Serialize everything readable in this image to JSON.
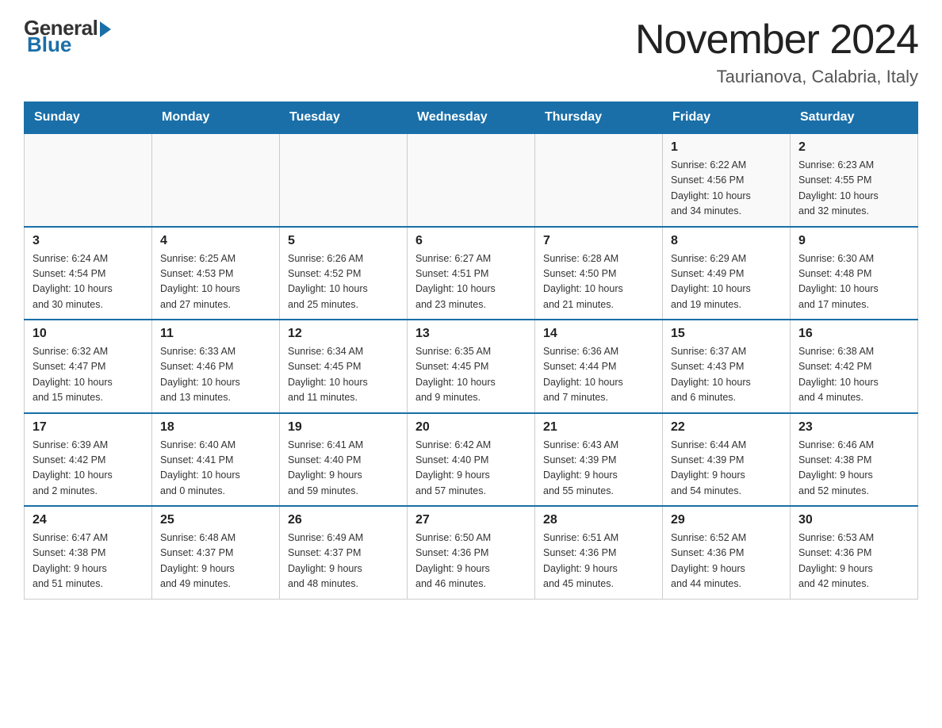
{
  "header": {
    "logo": {
      "general": "General",
      "blue": "Blue"
    },
    "month": "November 2024",
    "location": "Taurianova, Calabria, Italy"
  },
  "weekdays": [
    "Sunday",
    "Monday",
    "Tuesday",
    "Wednesday",
    "Thursday",
    "Friday",
    "Saturday"
  ],
  "weeks": [
    [
      {
        "day": "",
        "info": ""
      },
      {
        "day": "",
        "info": ""
      },
      {
        "day": "",
        "info": ""
      },
      {
        "day": "",
        "info": ""
      },
      {
        "day": "",
        "info": ""
      },
      {
        "day": "1",
        "info": "Sunrise: 6:22 AM\nSunset: 4:56 PM\nDaylight: 10 hours\nand 34 minutes."
      },
      {
        "day": "2",
        "info": "Sunrise: 6:23 AM\nSunset: 4:55 PM\nDaylight: 10 hours\nand 32 minutes."
      }
    ],
    [
      {
        "day": "3",
        "info": "Sunrise: 6:24 AM\nSunset: 4:54 PM\nDaylight: 10 hours\nand 30 minutes."
      },
      {
        "day": "4",
        "info": "Sunrise: 6:25 AM\nSunset: 4:53 PM\nDaylight: 10 hours\nand 27 minutes."
      },
      {
        "day": "5",
        "info": "Sunrise: 6:26 AM\nSunset: 4:52 PM\nDaylight: 10 hours\nand 25 minutes."
      },
      {
        "day": "6",
        "info": "Sunrise: 6:27 AM\nSunset: 4:51 PM\nDaylight: 10 hours\nand 23 minutes."
      },
      {
        "day": "7",
        "info": "Sunrise: 6:28 AM\nSunset: 4:50 PM\nDaylight: 10 hours\nand 21 minutes."
      },
      {
        "day": "8",
        "info": "Sunrise: 6:29 AM\nSunset: 4:49 PM\nDaylight: 10 hours\nand 19 minutes."
      },
      {
        "day": "9",
        "info": "Sunrise: 6:30 AM\nSunset: 4:48 PM\nDaylight: 10 hours\nand 17 minutes."
      }
    ],
    [
      {
        "day": "10",
        "info": "Sunrise: 6:32 AM\nSunset: 4:47 PM\nDaylight: 10 hours\nand 15 minutes."
      },
      {
        "day": "11",
        "info": "Sunrise: 6:33 AM\nSunset: 4:46 PM\nDaylight: 10 hours\nand 13 minutes."
      },
      {
        "day": "12",
        "info": "Sunrise: 6:34 AM\nSunset: 4:45 PM\nDaylight: 10 hours\nand 11 minutes."
      },
      {
        "day": "13",
        "info": "Sunrise: 6:35 AM\nSunset: 4:45 PM\nDaylight: 10 hours\nand 9 minutes."
      },
      {
        "day": "14",
        "info": "Sunrise: 6:36 AM\nSunset: 4:44 PM\nDaylight: 10 hours\nand 7 minutes."
      },
      {
        "day": "15",
        "info": "Sunrise: 6:37 AM\nSunset: 4:43 PM\nDaylight: 10 hours\nand 6 minutes."
      },
      {
        "day": "16",
        "info": "Sunrise: 6:38 AM\nSunset: 4:42 PM\nDaylight: 10 hours\nand 4 minutes."
      }
    ],
    [
      {
        "day": "17",
        "info": "Sunrise: 6:39 AM\nSunset: 4:42 PM\nDaylight: 10 hours\nand 2 minutes."
      },
      {
        "day": "18",
        "info": "Sunrise: 6:40 AM\nSunset: 4:41 PM\nDaylight: 10 hours\nand 0 minutes."
      },
      {
        "day": "19",
        "info": "Sunrise: 6:41 AM\nSunset: 4:40 PM\nDaylight: 9 hours\nand 59 minutes."
      },
      {
        "day": "20",
        "info": "Sunrise: 6:42 AM\nSunset: 4:40 PM\nDaylight: 9 hours\nand 57 minutes."
      },
      {
        "day": "21",
        "info": "Sunrise: 6:43 AM\nSunset: 4:39 PM\nDaylight: 9 hours\nand 55 minutes."
      },
      {
        "day": "22",
        "info": "Sunrise: 6:44 AM\nSunset: 4:39 PM\nDaylight: 9 hours\nand 54 minutes."
      },
      {
        "day": "23",
        "info": "Sunrise: 6:46 AM\nSunset: 4:38 PM\nDaylight: 9 hours\nand 52 minutes."
      }
    ],
    [
      {
        "day": "24",
        "info": "Sunrise: 6:47 AM\nSunset: 4:38 PM\nDaylight: 9 hours\nand 51 minutes."
      },
      {
        "day": "25",
        "info": "Sunrise: 6:48 AM\nSunset: 4:37 PM\nDaylight: 9 hours\nand 49 minutes."
      },
      {
        "day": "26",
        "info": "Sunrise: 6:49 AM\nSunset: 4:37 PM\nDaylight: 9 hours\nand 48 minutes."
      },
      {
        "day": "27",
        "info": "Sunrise: 6:50 AM\nSunset: 4:36 PM\nDaylight: 9 hours\nand 46 minutes."
      },
      {
        "day": "28",
        "info": "Sunrise: 6:51 AM\nSunset: 4:36 PM\nDaylight: 9 hours\nand 45 minutes."
      },
      {
        "day": "29",
        "info": "Sunrise: 6:52 AM\nSunset: 4:36 PM\nDaylight: 9 hours\nand 44 minutes."
      },
      {
        "day": "30",
        "info": "Sunrise: 6:53 AM\nSunset: 4:36 PM\nDaylight: 9 hours\nand 42 minutes."
      }
    ]
  ]
}
